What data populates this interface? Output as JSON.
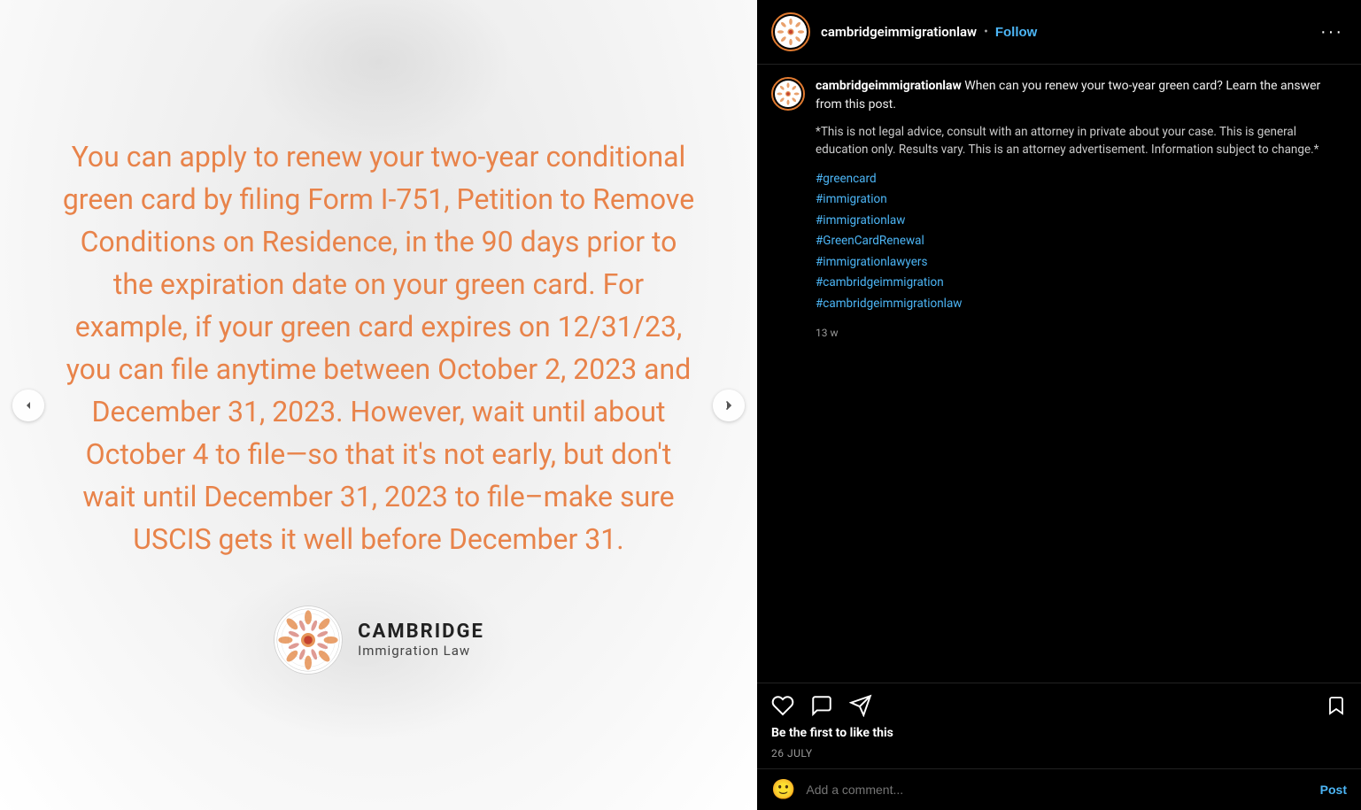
{
  "left": {
    "main_text": "You can apply to renew your two-year conditional green card by filing Form I-751, Petition to Remove Conditions on Residence, in the 90 days prior to the expiration date on your green card. For example, if your green card expires on 12/31/23, you can file anytime between October 2, 2023 and December 31, 2023. However, wait until about October 4 to file—so that it's not early, but don't wait until December 31, 2023 to file–make sure USCIS gets it well before December 31.",
    "logo_cambridge": "CAMBRIDGE",
    "logo_sub": "Immigration Law",
    "arrow_left": "‹",
    "arrow_right": "›"
  },
  "header": {
    "username": "cambridgeimmigrationlaw",
    "follow": "Follow",
    "more": "···"
  },
  "caption": {
    "username": "cambridgeimmigrationlaw",
    "body": " When can you renew your two-year green card? Learn the answer from this post.",
    "disclaimer": "*This is not legal advice, consult with an attorney in private about your case. This is general education only. Results vary. This is an attorney advertisement. Information subject to change.*",
    "hashtags": [
      "#greencard",
      "#immigration",
      "#immigrationlaw",
      "#GreenCardRenewal",
      "#immigrationlawyers",
      "#cambridgeimmigration",
      "#cambridgeimmigrationlaw"
    ],
    "timestamp": "13 w"
  },
  "actions": {
    "like": "heart",
    "comment": "bubble",
    "share": "paper-plane",
    "bookmark": "bookmark"
  },
  "likes": {
    "prefix": "Be the first to ",
    "bold": "like this"
  },
  "date": "26 JULY",
  "comment_placeholder": "Add a comment...",
  "post_label": "Post"
}
